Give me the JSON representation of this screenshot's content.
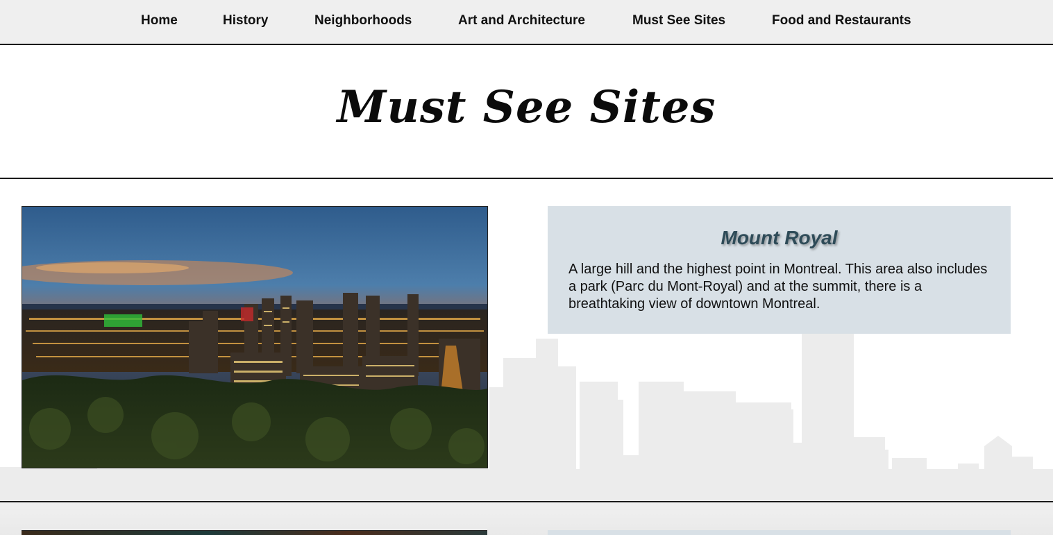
{
  "nav": {
    "items": [
      {
        "label": "Home"
      },
      {
        "label": "History"
      },
      {
        "label": "Neighborhoods"
      },
      {
        "label": "Art and Architecture"
      },
      {
        "label": "Must See Sites"
      },
      {
        "label": "Food and Restaurants"
      }
    ]
  },
  "header": {
    "title": "Must See Sites"
  },
  "sites": [
    {
      "title": "Mount Royal",
      "description": "A large hill and the highest point in Montreal. This area also includes a park (Parc du Mont-Royal) and at the summit, there is a breathtaking view of downtown Montreal."
    }
  ],
  "colors": {
    "nav_background": "#efefef",
    "card_background": "#d8e0e6",
    "card_title": "#2e4b58",
    "skyline_silhouette": "#ececec"
  }
}
